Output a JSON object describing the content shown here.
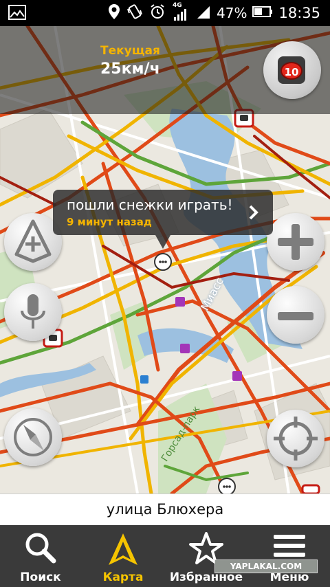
{
  "status_bar": {
    "network": "4G",
    "battery": "47%",
    "time": "18:35"
  },
  "speed": {
    "label": "Текущая",
    "value": "25км/ч"
  },
  "traffic": {
    "score": "10"
  },
  "map": {
    "river_label": "Миасс",
    "park_label": "Горсад-парк"
  },
  "bubble": {
    "text": "пошли снежки играть!",
    "time": "9 минут назад"
  },
  "street": {
    "name": "улица Блюхера"
  },
  "tabs": [
    {
      "label": "Поиск",
      "icon": "search-icon"
    },
    {
      "label": "Карта",
      "icon": "map-icon"
    },
    {
      "label": "Избранное",
      "icon": "star-icon"
    },
    {
      "label": "Меню",
      "icon": "menu-icon"
    }
  ],
  "watermark": "YAPLAKAL.COM",
  "colors": {
    "traffic_red": "#e04a18",
    "traffic_yellow": "#f0b400",
    "traffic_green": "#5ea53a",
    "traffic_darkred": "#a31f10",
    "active_tab": "#f5c400",
    "water": "#9cc0e0"
  }
}
